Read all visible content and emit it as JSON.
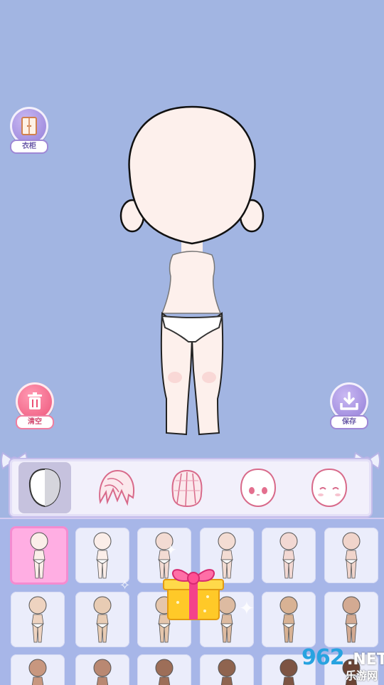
{
  "buttons": {
    "wardrobe": {
      "label": "衣柜",
      "icon": "wardrobe-icon"
    },
    "clear": {
      "label": "清空",
      "icon": "trash-icon"
    },
    "save": {
      "label": "保存",
      "icon": "download-icon"
    }
  },
  "tabs": [
    {
      "id": "skin",
      "icon": "skin-tab-icon",
      "active": true
    },
    {
      "id": "hair-front",
      "icon": "hair-front-icon",
      "active": false
    },
    {
      "id": "hair-back",
      "icon": "hair-back-icon",
      "active": false
    },
    {
      "id": "eyes",
      "icon": "eyes-icon",
      "active": false
    },
    {
      "id": "face",
      "icon": "face-icon",
      "active": false
    }
  ],
  "skin_tones": [
    {
      "color": "#fbeee9",
      "selected": true
    },
    {
      "color": "#fbeee9",
      "selected": false
    },
    {
      "color": "#f3dbd3",
      "selected": false
    },
    {
      "color": "#f3dcd3",
      "selected": false
    },
    {
      "color": "#f2d8d3",
      "selected": false
    },
    {
      "color": "#f0d4cb",
      "selected": false
    },
    {
      "color": "#eed3c0",
      "selected": false
    },
    {
      "color": "#e8ccb4",
      "selected": false
    },
    {
      "color": "#e5c6ac",
      "selected": false
    },
    {
      "color": "#ddbba1",
      "selected": false
    },
    {
      "color": "#d8b294",
      "selected": false
    },
    {
      "color": "#d3aa92",
      "selected": false
    },
    {
      "color": "#c8977f",
      "selected": false
    },
    {
      "color": "#b98872",
      "selected": false
    },
    {
      "color": "#9d6e58",
      "selected": false
    },
    {
      "color": "#8f644f",
      "selected": false
    },
    {
      "color": "#7d5443",
      "selected": false
    },
    {
      "color": "#6a4334",
      "selected": false
    }
  ],
  "watermark": {
    "logo": "962",
    "net": ".NET",
    "sub": "乐游网"
  },
  "colors": {
    "background": "#a2b5e2",
    "accent_purple": "#9f88d6",
    "accent_pink": "#ec4f75",
    "selected_tile": "#ffaee3"
  }
}
